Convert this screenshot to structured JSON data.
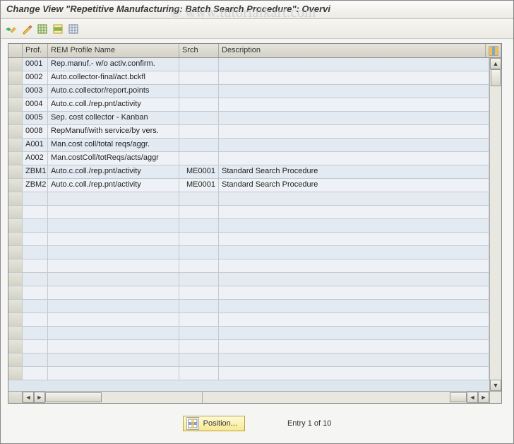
{
  "page_title": "Change View \"Repetitive Manufacturing: Batch Search Procedure\": Overvi",
  "watermark": "© www.tutorialkart.com",
  "toolbar_icons": [
    "glasses-pencil-icon",
    "pencil-icon",
    "select-all-icon",
    "select-block-icon",
    "deselect-all-icon"
  ],
  "columns": {
    "prof": "Prof.",
    "name": "REM Profile Name",
    "srch": "Srch",
    "desc": "Description"
  },
  "rows": [
    {
      "prof": "0001",
      "name": "Rep.manuf.- w/o activ.confirm.",
      "srch": "",
      "desc": ""
    },
    {
      "prof": "0002",
      "name": "Auto.collector-final/act.bckfl",
      "srch": "",
      "desc": ""
    },
    {
      "prof": "0003",
      "name": "Auto.c.collector/report.points",
      "srch": "",
      "desc": ""
    },
    {
      "prof": "0004",
      "name": "Auto.c.coll./rep.pnt/activity",
      "srch": "",
      "desc": ""
    },
    {
      "prof": "0005",
      "name": "Sep. cost collector - Kanban",
      "srch": "",
      "desc": ""
    },
    {
      "prof": "0008",
      "name": "RepManuf/with service/by vers.",
      "srch": "",
      "desc": ""
    },
    {
      "prof": "A001",
      "name": "Man.cost coll/total reqs/aggr.",
      "srch": "",
      "desc": ""
    },
    {
      "prof": "A002",
      "name": "Man.costColl/totReqs/acts/aggr",
      "srch": "",
      "desc": ""
    },
    {
      "prof": "ZBM1",
      "name": "Auto.c.coll./rep.pnt/activity",
      "srch": "ME0001",
      "desc": "Standard Search Procedure"
    },
    {
      "prof": "ZBM2",
      "name": "Auto.c.coll./rep.pnt/activity",
      "srch": "ME0001",
      "desc": "Standard Search Procedure"
    }
  ],
  "empty_rows": 14,
  "footer": {
    "position_button": "Position...",
    "entry_label": "Entry 1 of 10"
  }
}
